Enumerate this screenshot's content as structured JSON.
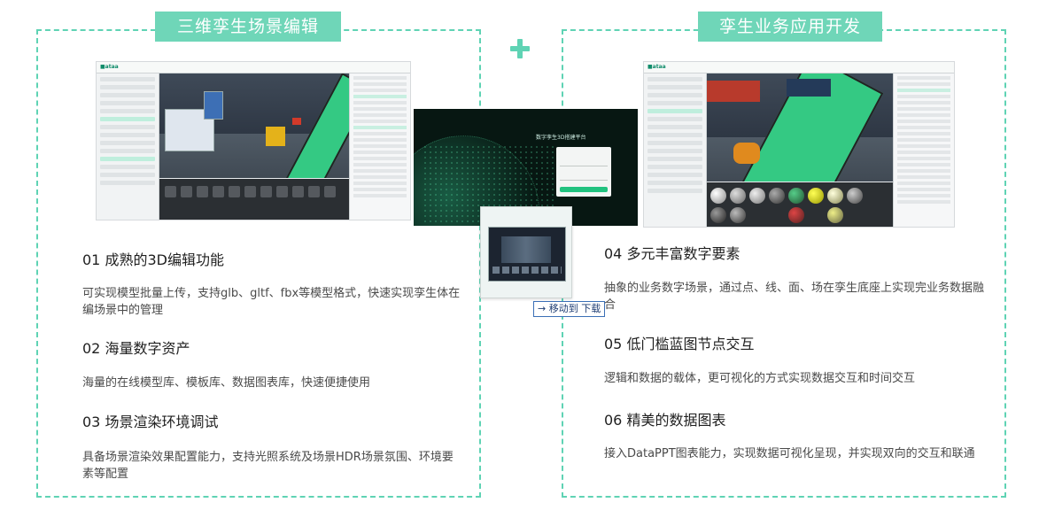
{
  "left_panel": {
    "title": "三维孪生场景编辑",
    "features": [
      {
        "title": "01 成熟的3D编辑功能",
        "desc": "可实现模型批量上传，支持glb、gltf、fbx等模型格式，快速实现孪生体在编场景中的管理"
      },
      {
        "title": "02 海量数字资产",
        "desc": "海量的在线模型库、模板库、数据图表库，快速便捷使用"
      },
      {
        "title": "03 场景渲染环境调试",
        "desc": "具备场景渲染效果配置能力，支持光照系统及场景HDR场景氛围、环境要素等配置"
      }
    ]
  },
  "right_panel": {
    "title": "孪生业务应用开发",
    "features": [
      {
        "title": "04 多元丰富数字要素",
        "desc": "抽象的业务数字场景，通过点、线、面、场在孪生底座上实现完业务数据融合"
      },
      {
        "title": "05 低门槛蓝图节点交互",
        "desc": "逻辑和数据的载体，更可视化的方式实现数据交互和时间交互"
      },
      {
        "title": "06 精美的数据图表",
        "desc": "接入DataPPT图表能力，实现数据可视化呈现，并实现双向的交互和联通"
      }
    ]
  },
  "overlay": {
    "login_title": "数字孪生3D搭建平台",
    "drag_tooltip": "→ 移动到 下载"
  },
  "colors": {
    "accent": "#5fd3b4",
    "title_bg": "#6fd6b8"
  },
  "icons": {
    "plus": "plus-icon"
  }
}
